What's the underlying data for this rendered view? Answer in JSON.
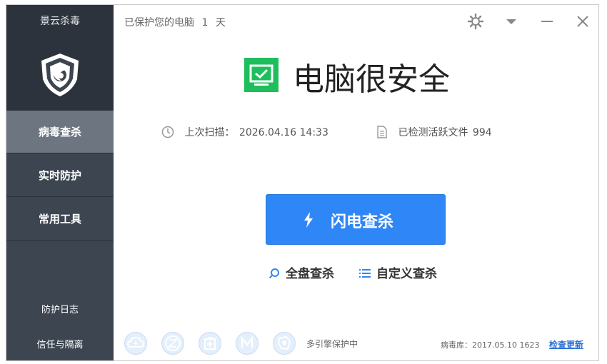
{
  "sidebar": {
    "app_name": "景云杀毒",
    "items": [
      {
        "label": "病毒查杀",
        "active": true
      },
      {
        "label": "实时防护",
        "active": false
      },
      {
        "label": "常用工具",
        "active": false
      }
    ],
    "bottom_links": [
      {
        "label": "防护日志"
      },
      {
        "label": "信任与隔离"
      }
    ]
  },
  "header": {
    "protected_prefix": "已保护您的电脑",
    "protected_days": "1",
    "protected_suffix": "天"
  },
  "main": {
    "headline": "电脑很安全",
    "last_scan_label": "上次扫描：",
    "last_scan_value": "2026.04.16 14:33",
    "files_label": "已检测活跃文件",
    "files_value": "994",
    "quick_scan_label": "闪电查杀",
    "full_scan_label": "全盘查杀",
    "custom_scan_label": "自定义查杀"
  },
  "footer": {
    "engines": [
      {
        "name": "cloud-engine-icon"
      },
      {
        "name": "z-engine-icon"
      },
      {
        "name": "medical-engine-icon"
      },
      {
        "name": "m-engine-icon"
      },
      {
        "name": "guard-engine-icon"
      }
    ],
    "engine_status": "多引擎保护中",
    "db_label": "病毒库：",
    "db_version": "2017.05.10 1623",
    "update_label": "检查更新"
  },
  "colors": {
    "sidebar_bg": "#3c4550",
    "sidebar_top_bg": "#2c333c",
    "sidebar_active": "#6c7580",
    "accent_blue": "#2f86f6",
    "safe_green": "#1fbe5c"
  }
}
